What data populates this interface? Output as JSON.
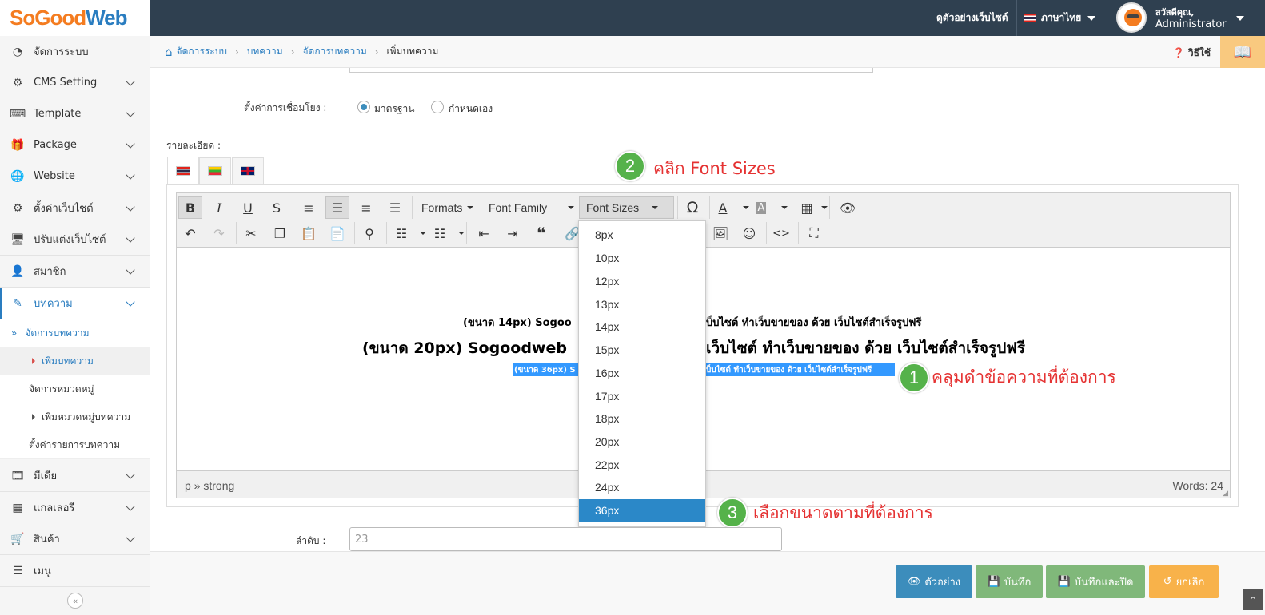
{
  "logo": {
    "part1": "SoGood",
    "part2": "Web"
  },
  "topbar": {
    "preview_site": "ดูตัวอย่างเว็บไซต์",
    "language": "ภาษาไทย",
    "greeting": "สวัสดีคุณ,",
    "user": "Administrator"
  },
  "sidebar": {
    "items": [
      {
        "label": "จัดการระบบ",
        "icon": "dashboard-icon"
      },
      {
        "label": "CMS Setting",
        "icon": "gear-icon"
      },
      {
        "label": "Template",
        "icon": "keyboard-icon"
      },
      {
        "label": "Package",
        "icon": "gift-icon"
      },
      {
        "label": "Website",
        "icon": "globe-icon"
      },
      {
        "label": "ตั้งค่าเว็บไซต์",
        "icon": "gear-icon"
      },
      {
        "label": "ปรับแต่งเว็บไซต์",
        "icon": "monitor-icon"
      },
      {
        "label": "สมาชิก",
        "icon": "user-icon"
      },
      {
        "label": "บทความ",
        "icon": "edit-icon"
      },
      {
        "label": "มีเดีย",
        "icon": "film-icon"
      },
      {
        "label": "แกลเลอรี",
        "icon": "grid-icon"
      },
      {
        "label": "สินค้า",
        "icon": "cart-icon"
      },
      {
        "label": "เมนู",
        "icon": "menu-icon"
      }
    ],
    "sub": [
      {
        "label": "จัดการบทความ"
      },
      {
        "label": "เพิ่มบทความ"
      },
      {
        "label": "จัดการหมวดหมู่"
      },
      {
        "label": "เพิ่มหมวดหมู่บทความ"
      },
      {
        "label": "ตั้งค่ารายการบทความ"
      }
    ]
  },
  "breadcrumb": {
    "home": "จัดการระบบ",
    "l2": "บทความ",
    "l3": "จัดการบทความ",
    "current": "เพิ่มบทความ"
  },
  "help": "วิธีใช้",
  "form": {
    "link_setting_label": "ตั้งค่าการเชื่อมโยง :",
    "radio_standard": "มาตรฐาน",
    "radio_custom": "กำหนดเอง",
    "detail_label": "รายละเอียด :",
    "order_label": "ลำดับ :",
    "order_value": "23"
  },
  "editor": {
    "formats": "Formats",
    "font_family": "Font Family",
    "font_sizes": "Font Sizes",
    "line1": "(ขนาด 14px) Sogoo",
    "line1b": "บ็บไซต์ ทำเว็บขายของ ด้วย เว็บไซต์สำเร็จรูปฟรี",
    "line2": "(ขนาด 20px) Sogoodweb",
    "line2b": "เว็บไซต์ ทำเว็บขายของ ด้วย เว็บไซต์สำเร็จรูปฟรี",
    "line3": "(ขนาด 36px) S",
    "line3b": "บ็บไซต์ ทำเว็บขายของ ด้วย เว็บไซต์สำเร็จรูปฟรี",
    "path": "p » strong",
    "words": "Words: 24"
  },
  "font_sizes": [
    "8px",
    "10px",
    "12px",
    "13px",
    "14px",
    "15px",
    "16px",
    "17px",
    "18px",
    "20px",
    "22px",
    "24px",
    "36px"
  ],
  "annotations": {
    "n1": "1",
    "t1": "คลุมดำข้อความที่ต้องการ",
    "n2": "2",
    "t2": "คลิก Font Sizes",
    "n3": "3",
    "t3": "เลือกขนาดตามที่ต้องการ"
  },
  "buttons": {
    "preview": "ตัวอย่าง",
    "save": "บันทึก",
    "save_close": "บันทึกและปิด",
    "cancel": "ยกเลิก"
  },
  "colors": {
    "primary": "#3c8dbc",
    "success": "#80b87a",
    "warning": "#f8b24a",
    "header": "#2f4050",
    "annotation": "#e53232",
    "badge": "#55b24a"
  }
}
